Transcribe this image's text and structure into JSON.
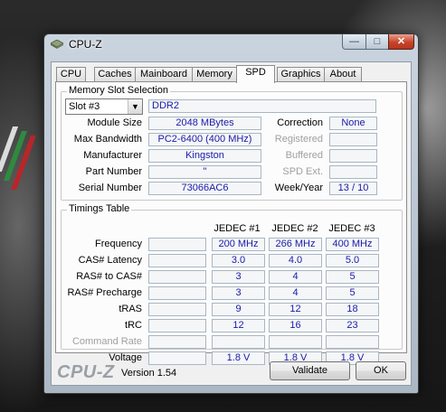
{
  "window": {
    "title": "CPU-Z",
    "controls": {
      "minimize": "—",
      "maximize": "□",
      "close": "✕"
    }
  },
  "tabs": [
    "CPU",
    "Caches",
    "Mainboard",
    "Memory",
    "SPD",
    "Graphics",
    "About"
  ],
  "active_tab": "SPD",
  "slot_selection": {
    "group_label": "Memory Slot Selection",
    "slot": "Slot #3",
    "type": "DDR2",
    "module_size_label": "Module Size",
    "module_size": "2048 MBytes",
    "max_bandwidth_label": "Max Bandwidth",
    "max_bandwidth": "PC2-6400 (400 MHz)",
    "manufacturer_label": "Manufacturer",
    "manufacturer": "Kingston",
    "part_number_label": "Part Number",
    "part_number": "\"",
    "serial_number_label": "Serial Number",
    "serial_number": "73066AC6",
    "correction_label": "Correction",
    "correction": "None",
    "registered_label": "Registered",
    "registered": "",
    "buffered_label": "Buffered",
    "buffered": "",
    "spd_ext_label": "SPD Ext.",
    "spd_ext": "",
    "week_year_label": "Week/Year",
    "week_year": "13 / 10"
  },
  "timings": {
    "group_label": "Timings Table",
    "columns": [
      "JEDEC #1",
      "JEDEC #2",
      "JEDEC #3"
    ],
    "rows": [
      {
        "label": "Frequency",
        "values": [
          "200 MHz",
          "266 MHz",
          "400 MHz"
        ]
      },
      {
        "label": "CAS# Latency",
        "values": [
          "3.0",
          "4.0",
          "5.0"
        ]
      },
      {
        "label": "RAS# to CAS#",
        "values": [
          "3",
          "4",
          "5"
        ]
      },
      {
        "label": "RAS# Precharge",
        "values": [
          "3",
          "4",
          "5"
        ]
      },
      {
        "label": "tRAS",
        "values": [
          "9",
          "12",
          "18"
        ]
      },
      {
        "label": "tRC",
        "values": [
          "12",
          "16",
          "23"
        ]
      },
      {
        "label": "Command Rate",
        "values": [
          "",
          "",
          ""
        ]
      },
      {
        "label": "Voltage",
        "values": [
          "1.8 V",
          "1.8 V",
          "1.8 V"
        ]
      }
    ]
  },
  "footer": {
    "logo": "CPU-Z",
    "version": "Version 1.54",
    "validate": "Validate",
    "ok": "OK"
  },
  "colors": {
    "value_text": "#1a1aa8",
    "disabled_label": "#a0a0a0"
  }
}
